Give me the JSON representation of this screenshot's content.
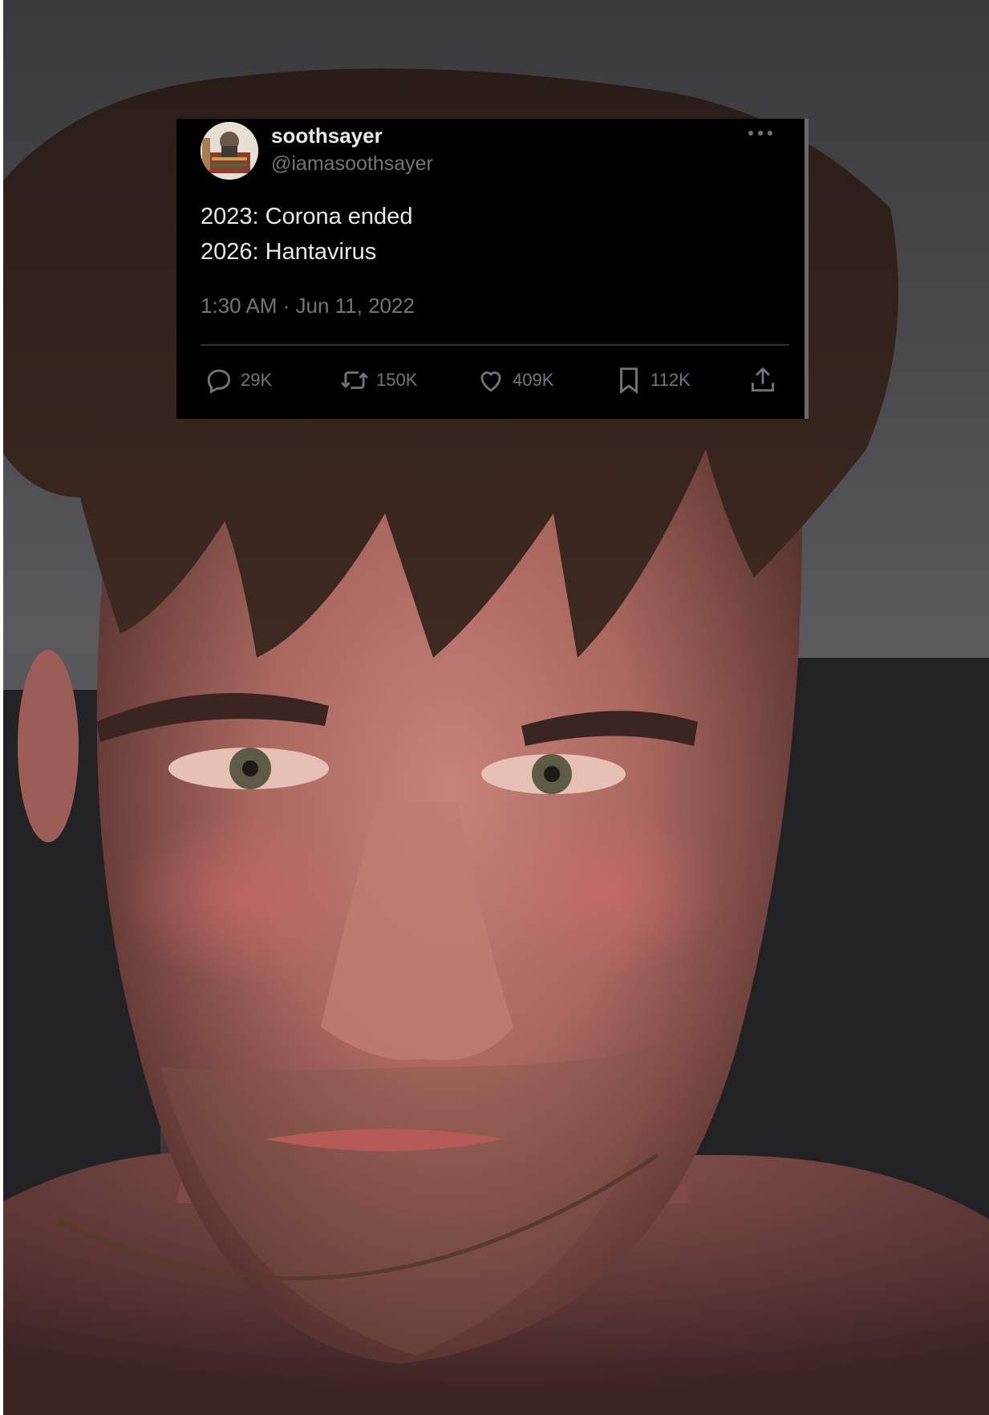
{
  "tweet": {
    "display_name": "soothsayer",
    "handle": "@iamasoothsayer",
    "text_lines": [
      "2023: Corona ended",
      "2026: Hantavirus"
    ],
    "timestamp": "1:30 AM · Jun 11, 2022",
    "more_icon": "ellipsis-icon",
    "actions": {
      "reply": {
        "icon": "reply-icon",
        "count": "29K"
      },
      "retweet": {
        "icon": "retweet-icon",
        "count": "150K"
      },
      "like": {
        "icon": "heart-icon",
        "count": "409K"
      },
      "bookmark": {
        "icon": "bookmark-icon",
        "count": "112K"
      },
      "share": {
        "icon": "share-icon"
      }
    }
  },
  "colors": {
    "card_background": "#000000",
    "primary_text": "#e7e9ea",
    "secondary_text": "#71767b",
    "divider": "#2f3336"
  }
}
